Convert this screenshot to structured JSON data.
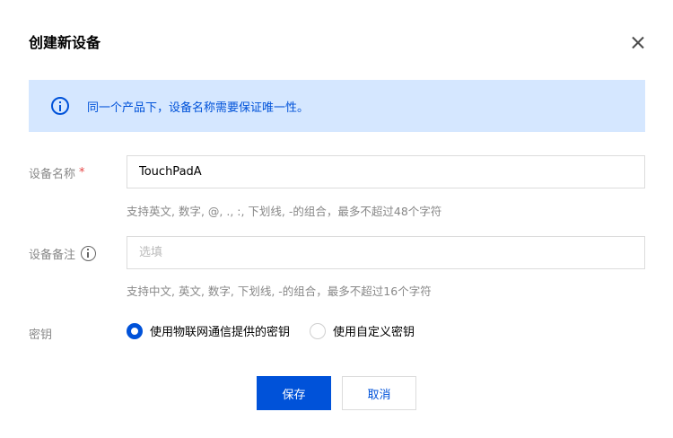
{
  "dialog": {
    "title": "创建新设备",
    "close_icon": "close-icon"
  },
  "notice": {
    "icon": "info-circle-icon",
    "text": "同一个产品下，设备名称需要保证唯一性。",
    "color": "#0052d9",
    "background": "#d5e7ff"
  },
  "device_name": {
    "label": "设备名称",
    "required_mark": "*",
    "value": "TouchPadA",
    "hint": "支持英文, 数字, @, ., :, 下划线, -的组合，最多不超过48个字符"
  },
  "device_note": {
    "label": "设备备注",
    "info_icon": "info-circle-icon",
    "placeholder": "选填",
    "hint": "支持中文, 英文, 数字, 下划线, -的组合，最多不超过16个字符"
  },
  "secret_key": {
    "label": "密钥",
    "options": [
      {
        "label": "使用物联网通信提供的密钥",
        "selected": true
      },
      {
        "label": "使用自定义密钥",
        "selected": false
      }
    ]
  },
  "actions": {
    "save_label": "保存",
    "cancel_label": "取消"
  },
  "colors": {
    "primary": "#0052d9",
    "required": "#e54545",
    "muted_text": "#888888"
  }
}
